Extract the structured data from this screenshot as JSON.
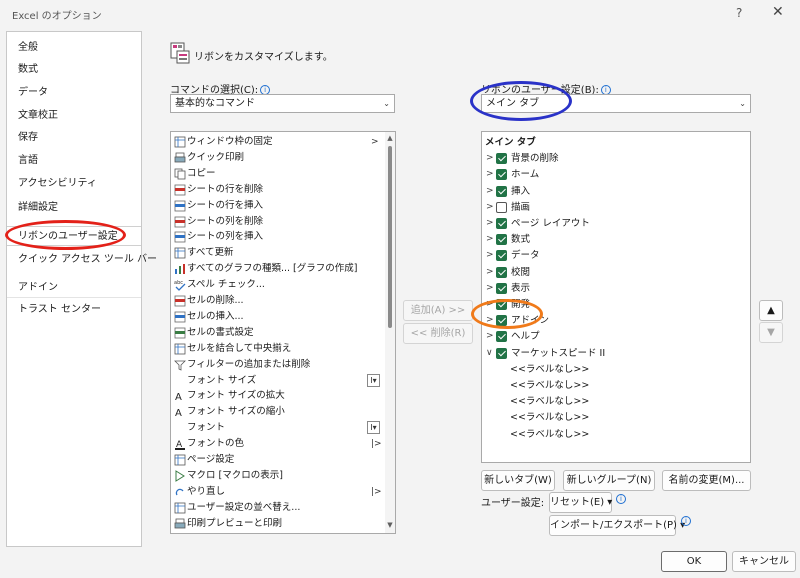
{
  "window": {
    "title": "Excel のオプション",
    "help": "?",
    "close": "✕"
  },
  "nav": {
    "items": [
      {
        "label": "全般"
      },
      {
        "label": "数式"
      },
      {
        "label": "データ"
      },
      {
        "label": "文章校正"
      },
      {
        "label": "保存"
      },
      {
        "label": "言語"
      },
      {
        "label": "アクセシビリティ"
      },
      {
        "label": "詳細設定"
      },
      {
        "label": "リボンのユーザー設定",
        "selected": true
      },
      {
        "label": "クイック アクセス ツール バー"
      },
      {
        "label": "アドイン"
      },
      {
        "label": "トラスト センター"
      }
    ]
  },
  "header": {
    "title": "リボンをカスタマイズします。"
  },
  "commands": {
    "label": "コマンドの選択(C):",
    "selected": "基本的なコマンド",
    "items": [
      {
        "label": "ウィンドウ枠の固定",
        "icon": "freeze-panes-icon",
        "arrow": true
      },
      {
        "label": "クイック印刷",
        "icon": "quick-print-icon"
      },
      {
        "label": "コピー",
        "icon": "copy-icon"
      },
      {
        "label": "シートの行を削除",
        "icon": "delete-rows-icon"
      },
      {
        "label": "シートの行を挿入",
        "icon": "insert-rows-icon"
      },
      {
        "label": "シートの列を削除",
        "icon": "delete-columns-icon"
      },
      {
        "label": "シートの列を挿入",
        "icon": "insert-columns-icon"
      },
      {
        "label": "すべて更新",
        "icon": "refresh-all-icon"
      },
      {
        "label": "すべてのグラフの種類... [グラフの作成]",
        "icon": "chart-types-icon"
      },
      {
        "label": "スペル チェック...",
        "icon": "spell-check-icon"
      },
      {
        "label": "セルの削除...",
        "icon": "delete-cells-icon"
      },
      {
        "label": "セルの挿入...",
        "icon": "insert-cells-icon"
      },
      {
        "label": "セルの書式設定",
        "icon": "format-cells-icon"
      },
      {
        "label": "セルを結合して中央揃え",
        "icon": "merge-center-icon"
      },
      {
        "label": "フィルターの追加または削除",
        "icon": "filter-icon"
      },
      {
        "label": "フォント サイズ",
        "icon": "",
        "extra": "I▾"
      },
      {
        "label": "フォント サイズの拡大",
        "icon": "font-grow-icon"
      },
      {
        "label": "フォント サイズの縮小",
        "icon": "font-shrink-icon"
      },
      {
        "label": "フォント",
        "icon": "",
        "extra": "I▾"
      },
      {
        "label": "フォントの色",
        "icon": "font-color-icon",
        "splitarrow": true
      },
      {
        "label": "ページ設定",
        "icon": "page-setup-icon"
      },
      {
        "label": "マクロ [マクロの表示]",
        "icon": "macro-icon"
      },
      {
        "label": "やり直し",
        "icon": "redo-icon",
        "splitarrow": true
      },
      {
        "label": "ユーザー設定の並べ替え...",
        "icon": "sort-icon"
      },
      {
        "label": "印刷プレビューと印刷",
        "icon": "print-preview-icon"
      }
    ]
  },
  "middle": {
    "add": "追加(A) >>",
    "remove": "<< 削除(R)"
  },
  "ribbon": {
    "label": "リボンのユーザー設定(B):",
    "selected": "メイン タブ",
    "tree": [
      {
        "label": "メイン タブ",
        "kind": "header"
      },
      {
        "label": "背景の削除",
        "checked": true,
        "chev": ">"
      },
      {
        "label": "ホーム",
        "checked": true,
        "chev": ">"
      },
      {
        "label": "挿入",
        "checked": true,
        "chev": ">"
      },
      {
        "label": "描画",
        "checked": false,
        "chev": ">"
      },
      {
        "label": "ページ レイアウト",
        "checked": true,
        "chev": ">"
      },
      {
        "label": "数式",
        "checked": true,
        "chev": ">"
      },
      {
        "label": "データ",
        "checked": true,
        "chev": ">"
      },
      {
        "label": "校閲",
        "checked": true,
        "chev": ">"
      },
      {
        "label": "表示",
        "checked": true,
        "chev": ">"
      },
      {
        "label": "開発",
        "checked": true,
        "chev": ">"
      },
      {
        "label": "アドイン",
        "checked": true,
        "chev": ">"
      },
      {
        "label": "ヘルプ",
        "checked": true,
        "chev": ">"
      },
      {
        "label": "マーケットスピード II",
        "checked": true,
        "chev": "∨",
        "selected": true
      },
      {
        "label": "<<ラベルなし>>",
        "kind": "child"
      },
      {
        "label": "<<ラベルなし>>",
        "kind": "child"
      },
      {
        "label": "<<ラベルなし>>",
        "kind": "child"
      },
      {
        "label": "<<ラベルなし>>",
        "kind": "child"
      },
      {
        "label": "<<ラベルなし>>",
        "kind": "child"
      }
    ],
    "new_tab": "新しいタブ(W)",
    "new_group": "新しいグループ(N)",
    "rename": "名前の変更(M)...",
    "user_settings_label": "ユーザー設定:",
    "reset": "リセット(E) ▾",
    "import_export": "インポート/エクスポート(P) ▾",
    "up": "▲",
    "down": "▼"
  },
  "footer": {
    "ok": "OK",
    "cancel": "キャンセル"
  },
  "colors": {
    "check_green": "#217346",
    "red_circle": "#e32119",
    "blue_circle": "#2a32c8",
    "orange_circle": "#f07a1a"
  }
}
